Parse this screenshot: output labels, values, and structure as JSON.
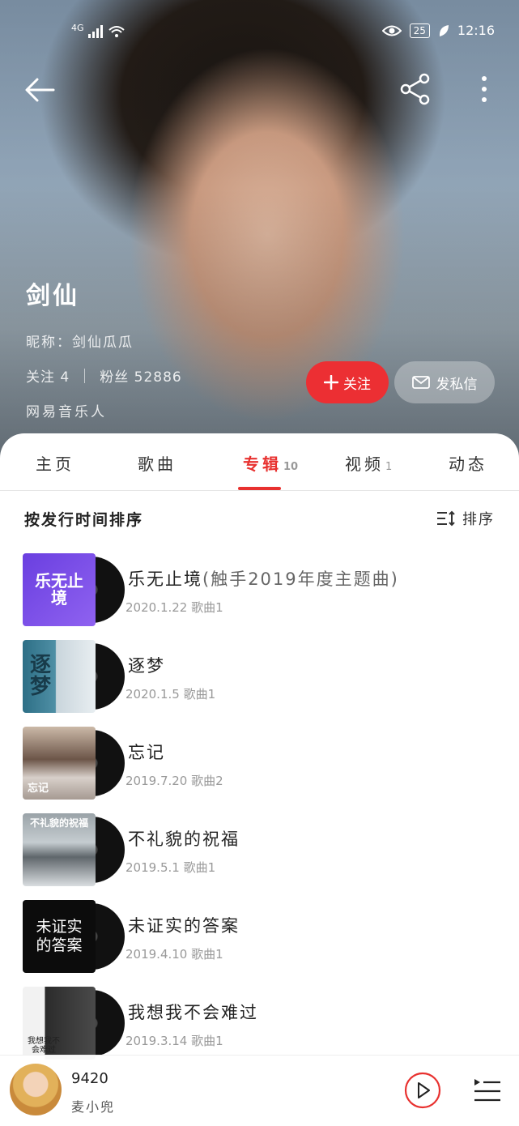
{
  "status_bar": {
    "network": "4G",
    "battery": "25",
    "time": "12:16"
  },
  "profile": {
    "artist_name": "剑仙",
    "nickname": "昵称：剑仙瓜瓜",
    "following": "关注 4",
    "fans": "粉丝 52886",
    "role": "网易音乐人",
    "follow_label": "关注",
    "message_label": "发私信"
  },
  "tabs": [
    {
      "label": "主页",
      "count": ""
    },
    {
      "label": "歌曲",
      "count": ""
    },
    {
      "label": "专辑",
      "count": "10"
    },
    {
      "label": "视频",
      "count": "1"
    },
    {
      "label": "动态",
      "count": ""
    }
  ],
  "active_tab": "专辑",
  "sort": {
    "label": "按发行时间排序",
    "button": "排序"
  },
  "albums": [
    {
      "title": "乐无止境",
      "subtitle": "(触手2019年度主题曲)",
      "meta": "2020.1.22 歌曲1",
      "cover_text": "乐无止境"
    },
    {
      "title": "逐梦",
      "subtitle": "",
      "meta": "2020.1.5 歌曲1",
      "cover_text": "逐梦"
    },
    {
      "title": "忘记",
      "subtitle": "",
      "meta": "2019.7.20 歌曲2",
      "cover_text": "忘记"
    },
    {
      "title": "不礼貌的祝福",
      "subtitle": "",
      "meta": "2019.5.1 歌曲1",
      "cover_text": "不礼貌的祝福"
    },
    {
      "title": "未证实的答案",
      "subtitle": "",
      "meta": "2019.4.10 歌曲1",
      "cover_text": "未证实的答案"
    },
    {
      "title": "我想我不会难过",
      "subtitle": "",
      "meta": "2019.3.14 歌曲1",
      "cover_text": "我想我不会难过"
    }
  ],
  "player": {
    "song": "9420",
    "artist": "麦小兜"
  },
  "colors": {
    "accent": "#e8312f",
    "follow_button": "#ec2f33"
  },
  "icons": [
    "back-arrow-icon",
    "share-icon",
    "more-vertical-icon",
    "plus-icon",
    "mail-icon",
    "sort-icon",
    "play-icon",
    "playlist-icon",
    "eye-icon",
    "leaf-icon",
    "wifi-icon",
    "signal-icon"
  ]
}
